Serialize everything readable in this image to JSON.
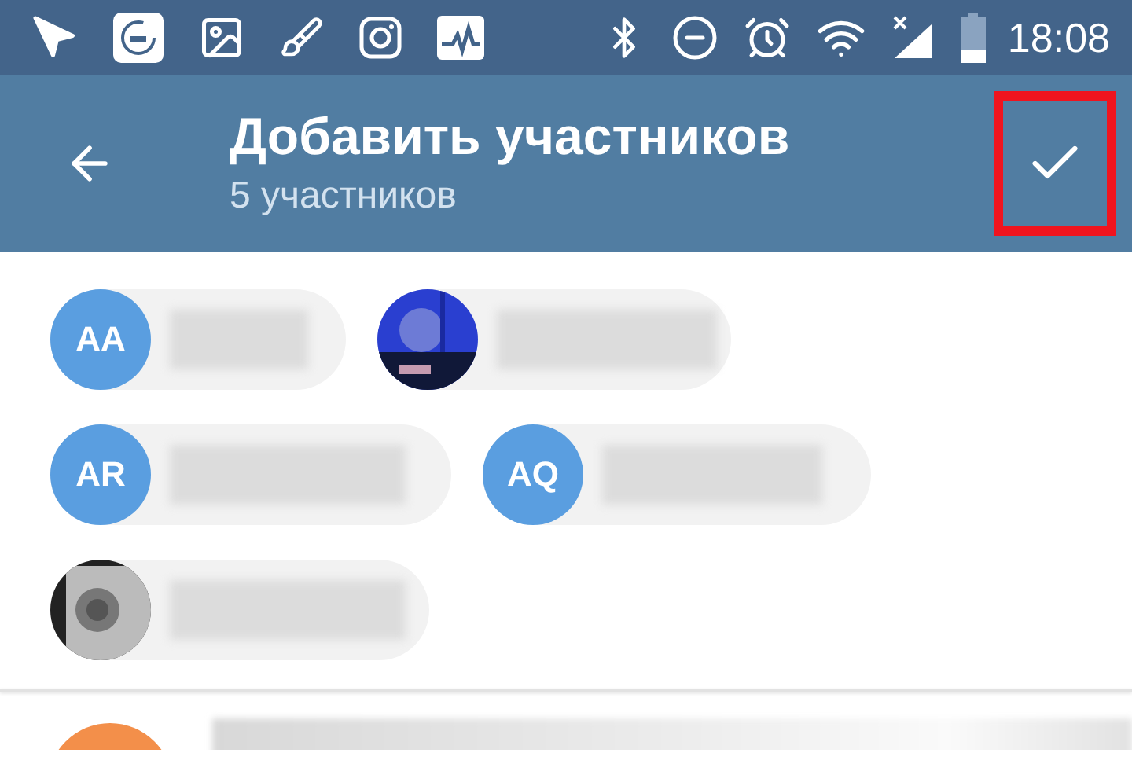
{
  "status_bar": {
    "time": "18:08"
  },
  "header": {
    "title": "Добавить участников",
    "subtitle": "5 участников",
    "confirm_highlighted": true
  },
  "chips": [
    {
      "kind": "initials",
      "initials": "AA"
    },
    {
      "kind": "picture"
    },
    {
      "kind": "initials",
      "initials": "AR"
    },
    {
      "kind": "initials",
      "initials": "AQ"
    },
    {
      "kind": "picture"
    }
  ]
}
